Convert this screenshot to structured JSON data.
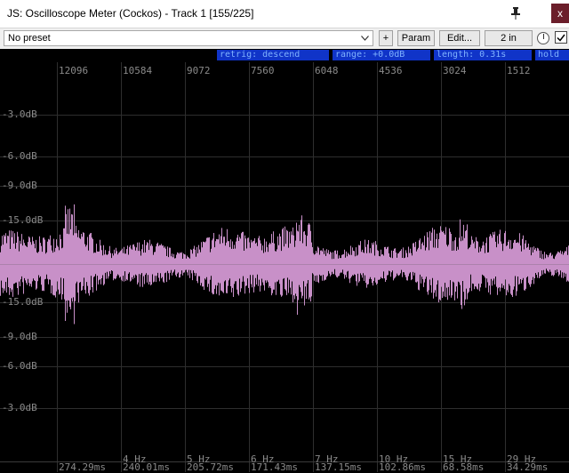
{
  "window": {
    "title": "JS: Oscilloscope Meter (Cockos) - Track 1 [155/225]",
    "close_label": "x"
  },
  "toolbar": {
    "preset": "No preset",
    "plus_label": "+",
    "param_label": "Param",
    "edit_label": "Edit...",
    "io_label": "2 in",
    "enabled": true
  },
  "status": {
    "retrig": "retrig: descend",
    "range": "range: +0.0dB",
    "length": "length: 0.31s",
    "hold": "hold"
  },
  "scope": {
    "top_ticks": [
      "12096",
      "10584",
      "9072",
      "7560",
      "6048",
      "4536",
      "3024",
      "1512"
    ],
    "db_labels": [
      "-3.0dB",
      "-6.0dB",
      "-9.0dB",
      "-15.0dB",
      "-15.0dB",
      "-9.0dB",
      "-6.0dB",
      "-3.0dB"
    ],
    "hz_labels": [
      "4 Hz",
      "5 Hz",
      "6 Hz",
      "7 Hz",
      "10 Hz",
      "15 Hz",
      "29 Hz"
    ],
    "ms_labels": [
      "274.29ms",
      "240.01ms",
      "205.72ms",
      "171.43ms",
      "137.15ms",
      "102.86ms",
      "68.58ms",
      "34.29ms"
    ],
    "colors": {
      "background": "#000000",
      "grid": "#2e2e2e",
      "center_line": "#4a4a4a",
      "waveform": "#c890c8",
      "label": "#8a8a8a"
    }
  }
}
